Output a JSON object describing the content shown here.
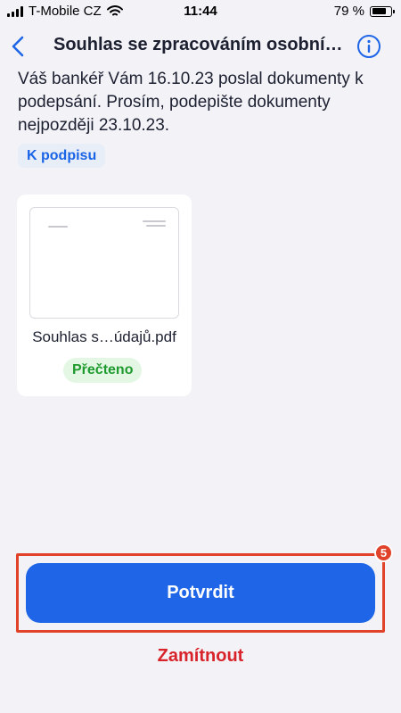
{
  "status_bar": {
    "carrier": "T-Mobile CZ",
    "time": "11:44",
    "battery_percent": "79 %",
    "battery_level": 0.79,
    "icons": [
      "signal-icon",
      "wifi-icon",
      "battery-icon"
    ]
  },
  "nav": {
    "title": "Souhlas se zpracováním osobní…",
    "back_icon": "chevron-left-icon",
    "info_icon": "info-circle-icon"
  },
  "message": "Váš bankéř Vám 16.10.23 poslal dokumenty k podepsání. Prosím, podepište dokumenty nejpozději 23.10.23.",
  "section_label": "K podpisu",
  "document": {
    "file_name": "Souhlas s…údajů.pdf",
    "status": "Přečteno"
  },
  "actions": {
    "confirm_label": "Potvrdit",
    "step_number": "5",
    "reject_label": "Zamítnout"
  },
  "colors": {
    "accent": "#1e66e7",
    "danger": "#d8232a",
    "highlight": "#e1432a",
    "success": "#1f9a2e",
    "background": "#f2f2f7"
  }
}
